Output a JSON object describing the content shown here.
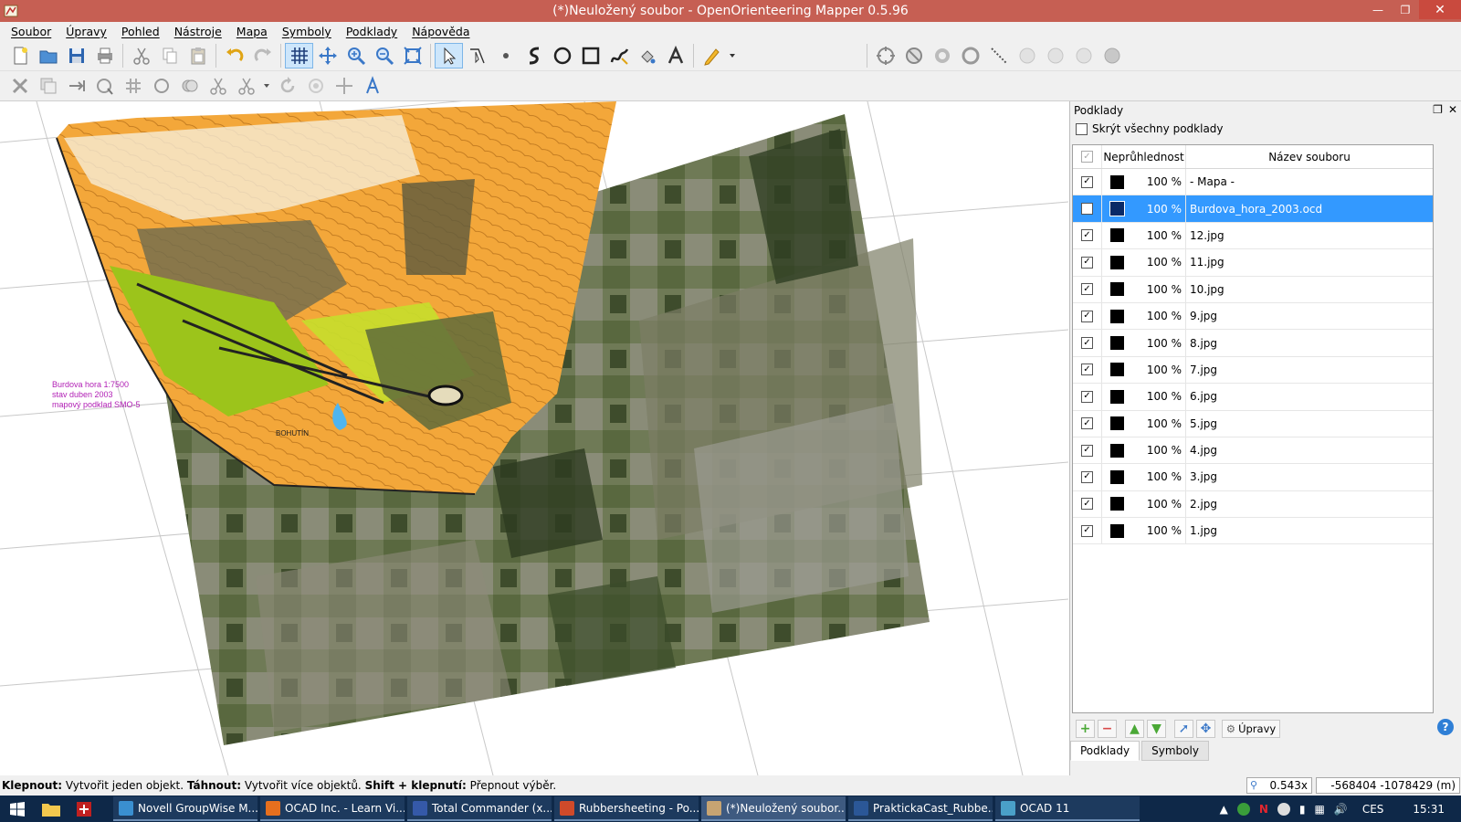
{
  "window": {
    "title": "(*)Neuložený soubor - OpenOrienteering Mapper 0.5.96"
  },
  "menu": [
    "Soubor",
    "Úpravy",
    "Pohled",
    "Nástroje",
    "Mapa",
    "Symboly",
    "Podklady",
    "Nápověda"
  ],
  "canvas": {
    "map_note_lines": [
      "Burdova hora 1:7500",
      "stav duben 2003",
      "mapový podklad SMO-5"
    ],
    "town_label": "BOHUTÍN"
  },
  "panel": {
    "title": "Podklady",
    "hide_all_label": "Skrýt všechny podklady",
    "columns": {
      "opacity": "Neprůhlednost",
      "filename": "Název souboru"
    },
    "rows": [
      {
        "opacity": "100 %",
        "name": "- Mapa -",
        "selected": false
      },
      {
        "opacity": "100 %",
        "name": "Burdova_hora_2003.ocd",
        "selected": true
      },
      {
        "opacity": "100 %",
        "name": "12.jpg",
        "selected": false
      },
      {
        "opacity": "100 %",
        "name": "11.jpg",
        "selected": false
      },
      {
        "opacity": "100 %",
        "name": "10.jpg",
        "selected": false
      },
      {
        "opacity": "100 %",
        "name": "9.jpg",
        "selected": false
      },
      {
        "opacity": "100 %",
        "name": "8.jpg",
        "selected": false
      },
      {
        "opacity": "100 %",
        "name": "7.jpg",
        "selected": false
      },
      {
        "opacity": "100 %",
        "name": "6.jpg",
        "selected": false
      },
      {
        "opacity": "100 %",
        "name": "5.jpg",
        "selected": false
      },
      {
        "opacity": "100 %",
        "name": "4.jpg",
        "selected": false
      },
      {
        "opacity": "100 %",
        "name": "3.jpg",
        "selected": false
      },
      {
        "opacity": "100 %",
        "name": "2.jpg",
        "selected": false
      },
      {
        "opacity": "100 %",
        "name": "1.jpg",
        "selected": false
      }
    ],
    "edit_button": "Úpravy",
    "help": "?",
    "tabs": [
      "Podklady",
      "Symboly"
    ]
  },
  "status": {
    "parts": [
      {
        "bold": true,
        "text": "Klepnout:"
      },
      {
        "bold": false,
        "text": " Vytvořit jeden objekt. "
      },
      {
        "bold": true,
        "text": "Táhnout:"
      },
      {
        "bold": false,
        "text": " Vytvořit více objektů. "
      },
      {
        "bold": true,
        "text": "Shift + klepnutí:"
      },
      {
        "bold": false,
        "text": " Přepnout výběr."
      }
    ],
    "zoom": "0.543x",
    "coords": "-568404 -1078429 (m)"
  },
  "taskbar": {
    "items": [
      {
        "label": "Novell GroupWise M...",
        "color": "#3a8fd0"
      },
      {
        "label": "OCAD Inc. - Learn Vi...",
        "color": "#e66f1e"
      },
      {
        "label": "Total Commander (x...",
        "color": "#3559a8"
      },
      {
        "label": "Rubbersheeting - Po...",
        "color": "#d04a2a"
      },
      {
        "label": "(*)Neuložený soubor...",
        "color": "#c7a472"
      },
      {
        "label": "PraktickaCast_Rubbe...",
        "color": "#2b5797"
      },
      {
        "label": "OCAD 11",
        "color": "#4aa0c8"
      }
    ],
    "lang": "CES",
    "time": "15:31"
  }
}
